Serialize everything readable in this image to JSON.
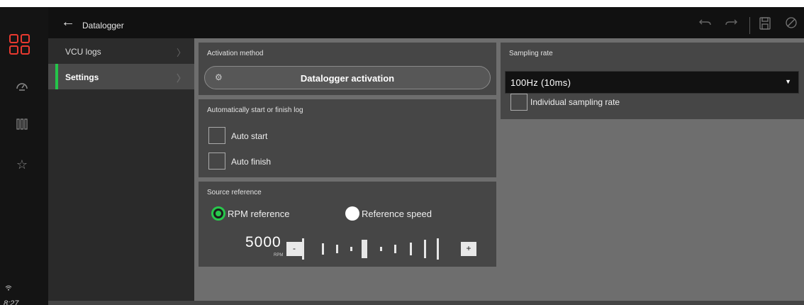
{
  "header": {
    "title": "Datalogger",
    "back_icon": "back-arrow-icon",
    "undo_icon": "undo-icon",
    "redo_icon": "redo-icon",
    "save_icon": "save-icon",
    "cancel_icon": "cancel-icon"
  },
  "status": {
    "clock": "8:27",
    "wifi_icon": "wifi-icon"
  },
  "rail": {
    "items": [
      {
        "icon": "app-grid-icon",
        "active": true
      },
      {
        "icon": "dashboard-gauge-icon"
      },
      {
        "icon": "columns-icon"
      },
      {
        "icon": "star-icon"
      }
    ]
  },
  "sidenav": {
    "items": [
      {
        "label": "VCU logs",
        "active": false
      },
      {
        "label": "Settings",
        "active": true
      }
    ],
    "active_color": "#24c44a"
  },
  "activation": {
    "title": "Activation method",
    "button_label": "Datalogger activation",
    "button_icon": "gear-icon"
  },
  "auto_log": {
    "title": "Automatically start or finish log",
    "auto_start": {
      "label": "Auto start",
      "checked": false
    },
    "auto_finish": {
      "label": "Auto finish",
      "checked": false
    }
  },
  "source": {
    "title": "Source reference",
    "options": [
      {
        "label": "RPM reference",
        "selected": true
      },
      {
        "label": "Reference speed",
        "selected": false
      }
    ],
    "rpm_value": "5000",
    "rpm_unit": "RPM",
    "minus_label": "-",
    "plus_label": "+"
  },
  "sampling": {
    "title": "Sampling rate",
    "selected": "100Hz (10ms)",
    "individual": {
      "label": "Individual sampling rate",
      "checked": false
    }
  },
  "colors": {
    "accent_green": "#28c84c",
    "brand_red": "#e8392f",
    "background_main": "#6e6e6e",
    "panel": "#464646"
  }
}
